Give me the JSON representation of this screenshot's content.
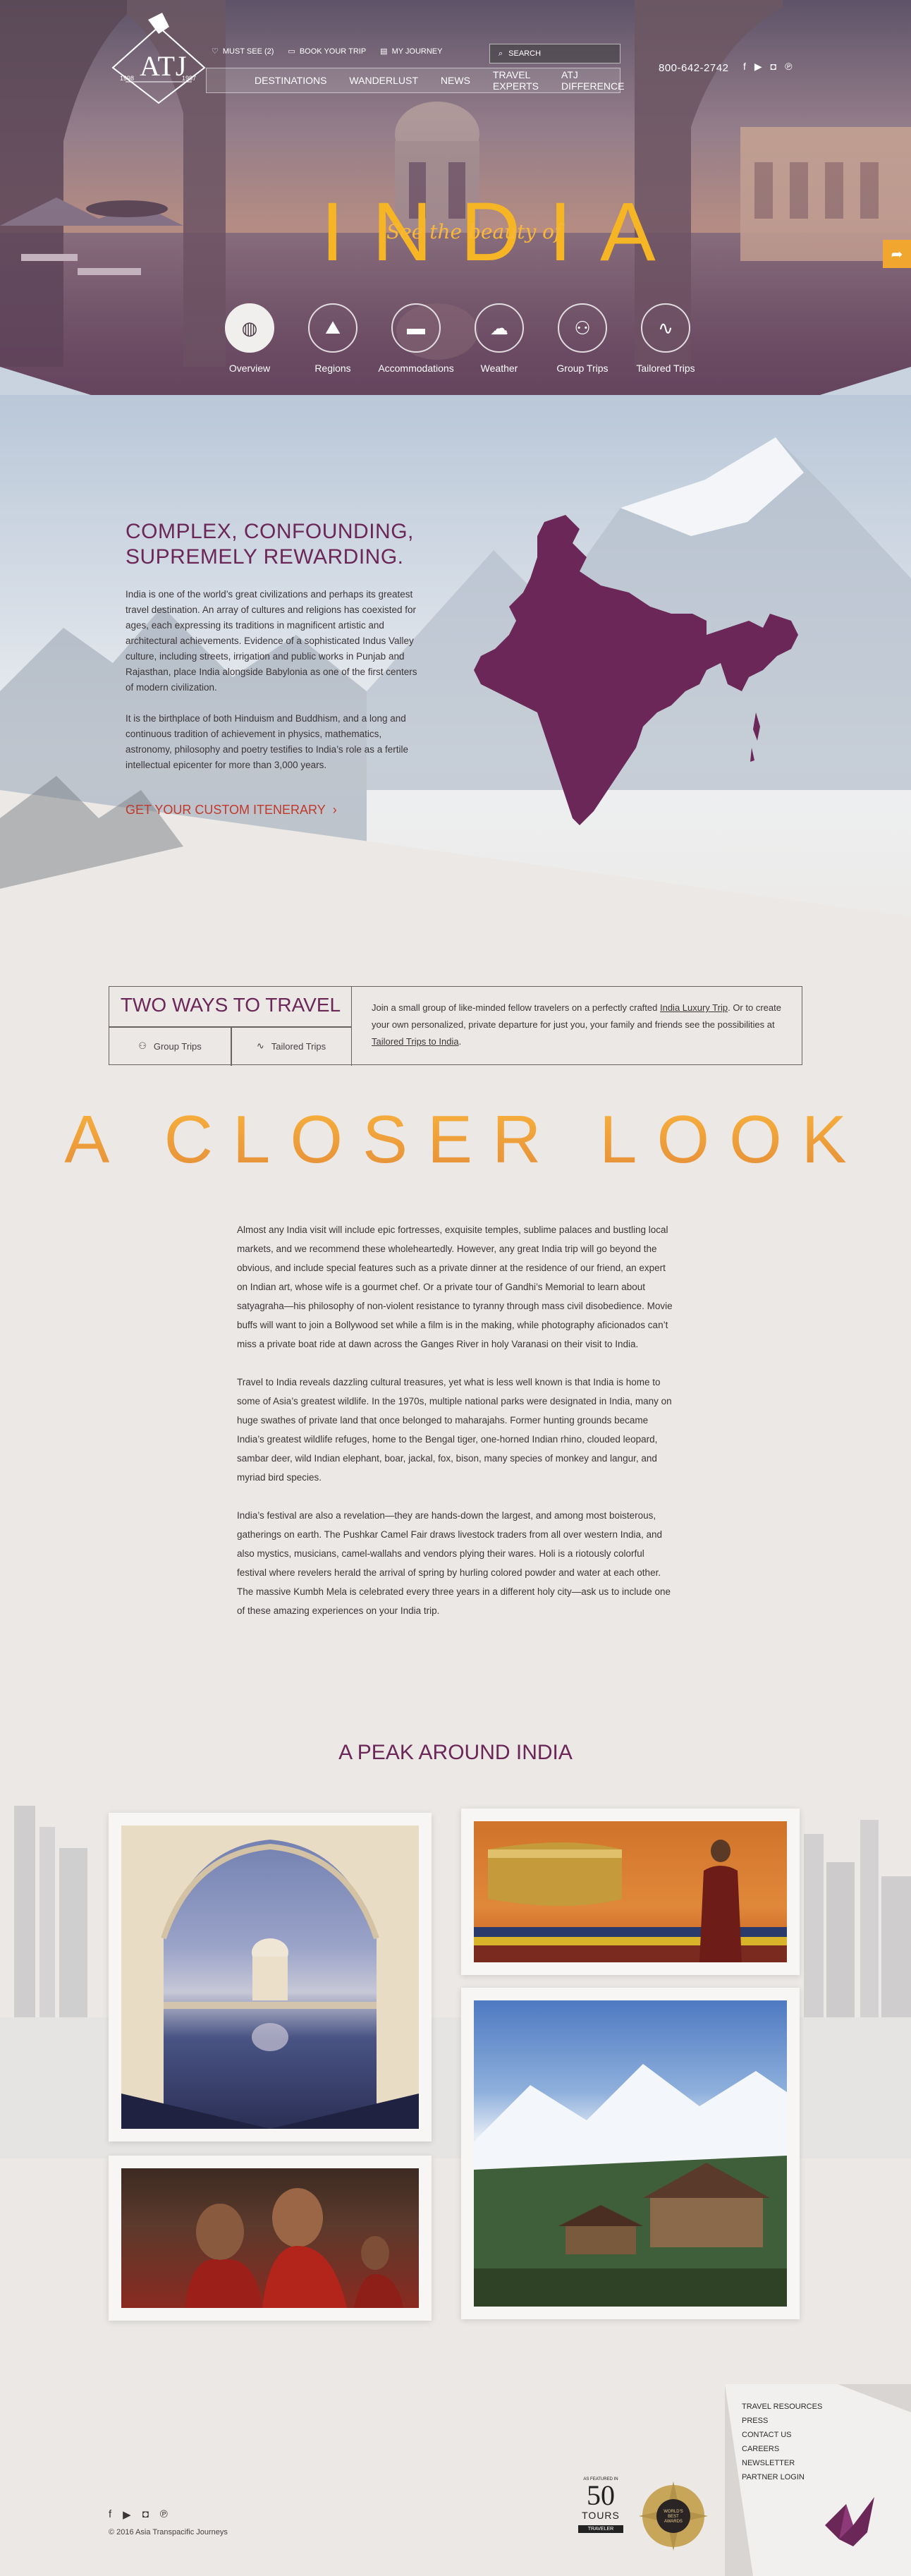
{
  "brand": {
    "logo": "ATJ",
    "year_left": "1998",
    "year_right": "1987"
  },
  "utility": {
    "must_see": "MUST SEE (2)",
    "book": "BOOK YOUR TRIP",
    "journey": "MY JOURNEY",
    "search": "SEARCH"
  },
  "nav": [
    "DESTINATIONS",
    "WANDERLUST",
    "NEWS",
    "TRAVEL EXPERTS",
    "ATJ DIFFERENCE"
  ],
  "phone": "800-642-2742",
  "hero": {
    "title": "INDIA",
    "subtitle": "See the beauty of"
  },
  "subnav": [
    {
      "label": "Overview",
      "icon": "globe-icon"
    },
    {
      "label": "Regions",
      "icon": "mountain-icon"
    },
    {
      "label": "Accommodations",
      "icon": "bed-icon"
    },
    {
      "label": "Weather",
      "icon": "cloud-icon"
    },
    {
      "label": "Group Trips",
      "icon": "group-icon"
    },
    {
      "label": "Tailored Trips",
      "icon": "path-icon"
    }
  ],
  "intro": {
    "title_1": "COMPLEX, CONFOUNDING,",
    "title_2": "SUPREMELY REWARDING.",
    "para_1": "India is one of the world’s great civilizations and perhaps its greatest travel destination. An array of cultures and religions has coexisted for ages, each expressing its traditions in magnificent artistic and architectural achievements. Evidence of a sophisticated Indus Valley culture, including streets, irrigation and public works in Punjab and Rajasthan, place India alongside Babylonia as one of the first centers of modern civilization.",
    "para_2": "It is the birthplace of both Hinduism and Buddhism, and a long and continuous tradition of achievement in physics, mathematics, astronomy, philosophy and poetry testifies to India’s role as a fertile intellectual epicenter for more than 3,000 years.",
    "cta": "GET YOUR CUSTOM ITENERARY"
  },
  "ways": {
    "title": "TWO WAYS TO TRAVEL",
    "group": "Group Trips",
    "tailored": "Tailored Trips",
    "desc_1": "Join a small group of like-minded fellow travelers on a perfectly crafted",
    "link_1": "India Luxury Trip",
    "desc_2": ". Or to create your own personalized, private departure for just you, your family and friends see the possibilities at",
    "link_2": "Tailored Trips to India",
    "desc_3": "."
  },
  "closer": {
    "title": "A CLOSER LOOK",
    "para_1": "Almost any India visit will include epic fortresses, exquisite temples, sublime palaces and bustling local markets, and we recommend these wholeheartedly. However, any great India trip will go beyond the obvious, and include special features such as a private dinner at the residence of our friend, an expert on Indian art, whose wife is a gourmet chef. Or a private tour of Gandhi’s Memorial to learn about satyagraha—his philosophy of non-violent resistance to tyranny through mass civil disobedience. Movie buffs will want to join a Bollywood set while a film is in the making, while photography aficionados can’t miss a private boat ride at dawn across the Ganges River in holy Varanasi on their visit to India.",
    "para_2": "Travel to India reveals dazzling cultural treasures, yet what is less well known is that India is home to some of Asia’s greatest wildlife. In the 1970s, multiple national parks were designated in India, many on huge swathes of private land that once belonged to maharajahs. Former hunting grounds became India’s greatest wildlife refuges, home to the Bengal tiger, one-horned Indian rhino, clouded leopard, sambar deer, wild Indian elephant, boar, jackal, fox, bison, many species of monkey and langur, and myriad bird species.",
    "para_3": "India’s festival are also a revelation—they are hands-down the largest, and among most boisterous, gatherings on earth. The Pushkar Camel Fair draws livestock traders from all over western India, and also mystics, musicians, camel-wallahs and vendors plying their wares. Holi is a riotously colorful festival where revelers herald the arrival of spring by hurling colored powder and water at each other. The massive Kumbh Mela is celebrated every three years in a different holy city—ask us to include one of these amazing experiences on your India trip."
  },
  "peak": {
    "title": "A PEAK AROUND INDIA"
  },
  "footer": {
    "links": [
      "TRAVEL RESOURCES",
      "PRESS",
      "CONTACT US",
      "CAREERS",
      "NEWSLETTER",
      "PARTNER LOGIN"
    ],
    "copyright": "© 2016 Asia Transpacific Journeys",
    "badge_top": "AS FEATURED IN",
    "badge_num": "50",
    "badge_word": "TOURS",
    "badge_bottom": "TRAVELER",
    "award_text": "WORLD'S BEST AWARDS"
  },
  "colors": {
    "accent_orange": "#f2a43a",
    "purple": "#6b2758",
    "cta_red": "#c0392b"
  }
}
